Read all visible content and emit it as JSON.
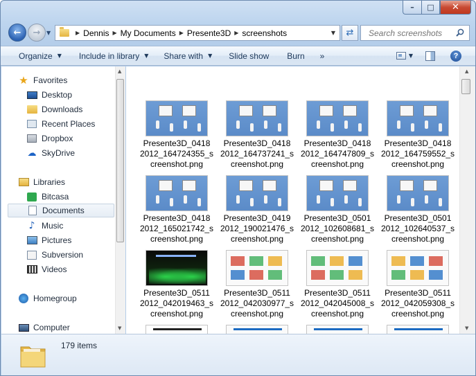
{
  "window": {
    "caption": {
      "minimize": "–",
      "maximize": "□",
      "close": "✕"
    }
  },
  "address": {
    "back_icon": "back-arrow-icon",
    "forward_icon": "forward-arrow-icon",
    "breadcrumbs": [
      "Dennis",
      "My Documents",
      "Presente3D",
      "screenshots"
    ],
    "search_placeholder": "Search screenshots"
  },
  "toolbar": {
    "organize": "Organize",
    "include_in_library": "Include in library",
    "share_with": "Share with",
    "slide_show": "Slide show",
    "burn": "Burn",
    "more": "»"
  },
  "nav": {
    "favorites": "Favorites",
    "desktop": "Desktop",
    "downloads": "Downloads",
    "recent_places": "Recent Places",
    "dropbox": "Dropbox",
    "skydrive": "SkyDrive",
    "libraries": "Libraries",
    "bitcasa": "Bitcasa",
    "documents": "Documents",
    "music": "Music",
    "pictures": "Pictures",
    "subversion": "Subversion",
    "videos": "Videos",
    "homegroup": "Homegroup",
    "computer": "Computer",
    "selected": "Documents"
  },
  "files": [
    {
      "line1": "Presente3D_0418",
      "line2": "2012_164724355_s",
      "line3": "creenshot.png",
      "style": "blue"
    },
    {
      "line1": "Presente3D_0418",
      "line2": "2012_164737241_s",
      "line3": "creenshot.png",
      "style": "blue"
    },
    {
      "line1": "Presente3D_0418",
      "line2": "2012_164747809_s",
      "line3": "creenshot.png",
      "style": "blue"
    },
    {
      "line1": "Presente3D_0418",
      "line2": "2012_164759552_s",
      "line3": "creenshot.png",
      "style": "blue"
    },
    {
      "line1": "Presente3D_0418",
      "line2": "2012_165021742_s",
      "line3": "creenshot.png",
      "style": "blue"
    },
    {
      "line1": "Presente3D_0419",
      "line2": "2012_190021476_s",
      "line3": "creenshot.png",
      "style": "blue"
    },
    {
      "line1": "Presente3D_0501",
      "line2": "2012_102608681_s",
      "line3": "creenshot.png",
      "style": "blue"
    },
    {
      "line1": "Presente3D_0501",
      "line2": "2012_102640537_s",
      "line3": "creenshot.png",
      "style": "blue"
    },
    {
      "line1": "Presente3D_0511",
      "line2": "2012_042019463_s",
      "line3": "creenshot.png",
      "style": "dark"
    },
    {
      "line1": "Presente3D_0511",
      "line2": "2012_042030977_s",
      "line3": "creenshot.png",
      "style": "white"
    },
    {
      "line1": "Presente3D_0511",
      "line2": "2012_042045008_s",
      "line3": "creenshot.png",
      "style": "white"
    },
    {
      "line1": "Presente3D_0511",
      "line2": "2012_042059308_s",
      "line3": "creenshot.png",
      "style": "white"
    }
  ],
  "details": {
    "item_count": "179 items"
  },
  "colors": {
    "accent": "#1e395b",
    "thumb_blue": "#5b8bc8",
    "selection": "#e6edf5"
  }
}
